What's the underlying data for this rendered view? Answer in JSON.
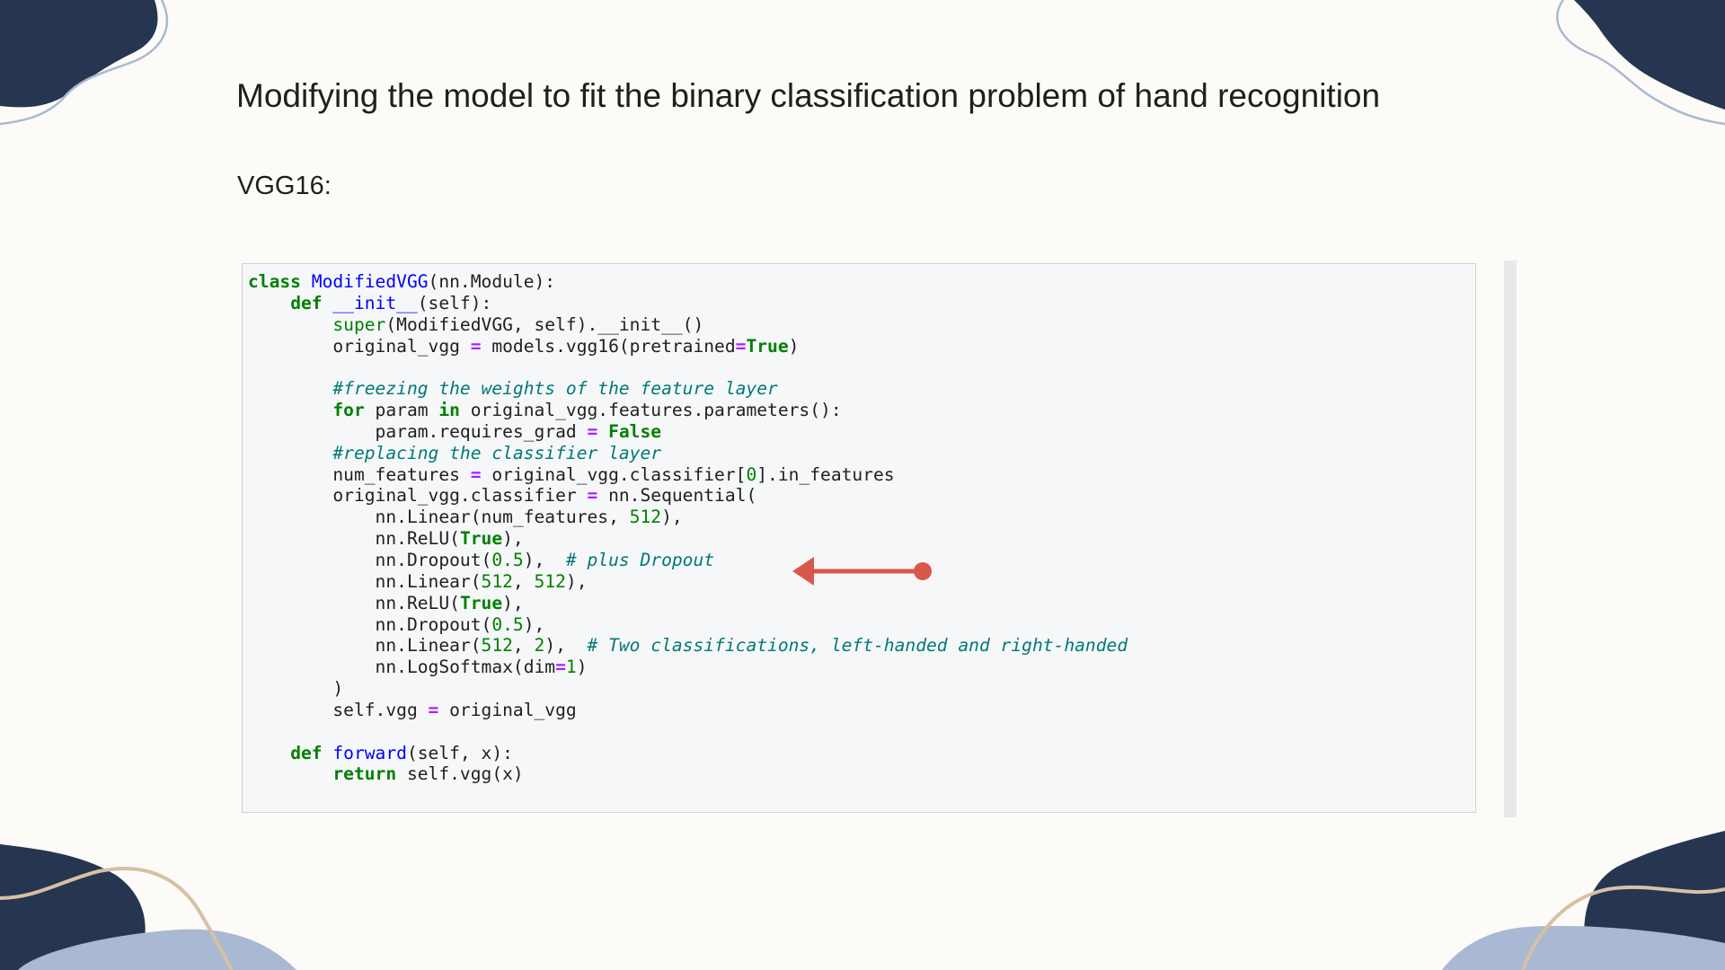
{
  "title": "Modifying the model to fit the binary classification problem of hand recognition",
  "section_label": "VGG16:",
  "code": {
    "language": "python",
    "lines": [
      [
        {
          "t": "class",
          "c": "kw"
        },
        {
          "t": " "
        },
        {
          "t": "ModifiedVGG",
          "c": "fn"
        },
        {
          "t": "(nn.Module):"
        }
      ],
      [
        {
          "t": "    "
        },
        {
          "t": "def",
          "c": "kw"
        },
        {
          "t": " "
        },
        {
          "t": "__init__",
          "c": "fn"
        },
        {
          "t": "(self):"
        }
      ],
      [
        {
          "t": "        "
        },
        {
          "t": "super",
          "c": "bi"
        },
        {
          "t": "(ModifiedVGG, self).__init__()"
        }
      ],
      [
        {
          "t": "        original_vgg "
        },
        {
          "t": "=",
          "c": "op"
        },
        {
          "t": " models.vgg16(pretrained"
        },
        {
          "t": "=",
          "c": "op"
        },
        {
          "t": "True",
          "c": "kw"
        },
        {
          "t": ")"
        }
      ],
      [],
      [
        {
          "t": "        "
        },
        {
          "t": "#freezing the weights of the feature layer",
          "c": "cm"
        }
      ],
      [
        {
          "t": "        "
        },
        {
          "t": "for",
          "c": "kw"
        },
        {
          "t": " param "
        },
        {
          "t": "in",
          "c": "kw"
        },
        {
          "t": " original_vgg.features.parameters():"
        }
      ],
      [
        {
          "t": "            param.requires_grad "
        },
        {
          "t": "=",
          "c": "op"
        },
        {
          "t": " "
        },
        {
          "t": "False",
          "c": "kw"
        }
      ],
      [
        {
          "t": "        "
        },
        {
          "t": "#replacing the classifier layer",
          "c": "cm"
        }
      ],
      [
        {
          "t": "        num_features "
        },
        {
          "t": "=",
          "c": "op"
        },
        {
          "t": " original_vgg.classifier["
        },
        {
          "t": "0",
          "c": "num"
        },
        {
          "t": "].in_features"
        }
      ],
      [
        {
          "t": "        original_vgg.classifier "
        },
        {
          "t": "=",
          "c": "op"
        },
        {
          "t": " nn.Sequential("
        }
      ],
      [
        {
          "t": "            nn.Linear(num_features, "
        },
        {
          "t": "512",
          "c": "num"
        },
        {
          "t": "),"
        }
      ],
      [
        {
          "t": "            nn.ReLU("
        },
        {
          "t": "True",
          "c": "kw"
        },
        {
          "t": "),"
        }
      ],
      [
        {
          "t": "            nn.Dropout("
        },
        {
          "t": "0.5",
          "c": "num"
        },
        {
          "t": "),  "
        },
        {
          "t": "# plus Dropout",
          "c": "cm"
        }
      ],
      [
        {
          "t": "            nn.Linear("
        },
        {
          "t": "512",
          "c": "num"
        },
        {
          "t": ", "
        },
        {
          "t": "512",
          "c": "num"
        },
        {
          "t": "),"
        }
      ],
      [
        {
          "t": "            nn.ReLU("
        },
        {
          "t": "True",
          "c": "kw"
        },
        {
          "t": "),"
        }
      ],
      [
        {
          "t": "            nn.Dropout("
        },
        {
          "t": "0.5",
          "c": "num"
        },
        {
          "t": "),"
        }
      ],
      [
        {
          "t": "            nn.Linear("
        },
        {
          "t": "512",
          "c": "num"
        },
        {
          "t": ", "
        },
        {
          "t": "2",
          "c": "num"
        },
        {
          "t": "),  "
        },
        {
          "t": "# Two classifications, left-handed and right-handed",
          "c": "cm"
        }
      ],
      [
        {
          "t": "            nn.LogSoftmax(dim"
        },
        {
          "t": "=",
          "c": "op"
        },
        {
          "t": "1",
          "c": "num"
        },
        {
          "t": ")"
        }
      ],
      [
        {
          "t": "        )"
        }
      ],
      [
        {
          "t": "        self.vgg "
        },
        {
          "t": "=",
          "c": "op"
        },
        {
          "t": " original_vgg"
        }
      ],
      [],
      [
        {
          "t": "    "
        },
        {
          "t": "def",
          "c": "kw"
        },
        {
          "t": " "
        },
        {
          "t": "forward",
          "c": "fn"
        },
        {
          "t": "(self, x):"
        }
      ],
      [
        {
          "t": "        "
        },
        {
          "t": "return",
          "c": "kw"
        },
        {
          "t": " self.vgg(x)"
        }
      ]
    ]
  },
  "colors": {
    "background": "#fdfbf8",
    "navy": "#263650",
    "light_blue": "#a9b9d3",
    "tan": "#d5c1a4",
    "arrow": "#d9574a"
  },
  "annotation": {
    "type": "arrow",
    "points_to": "nn.Dropout(0.5),  # plus Dropout"
  }
}
